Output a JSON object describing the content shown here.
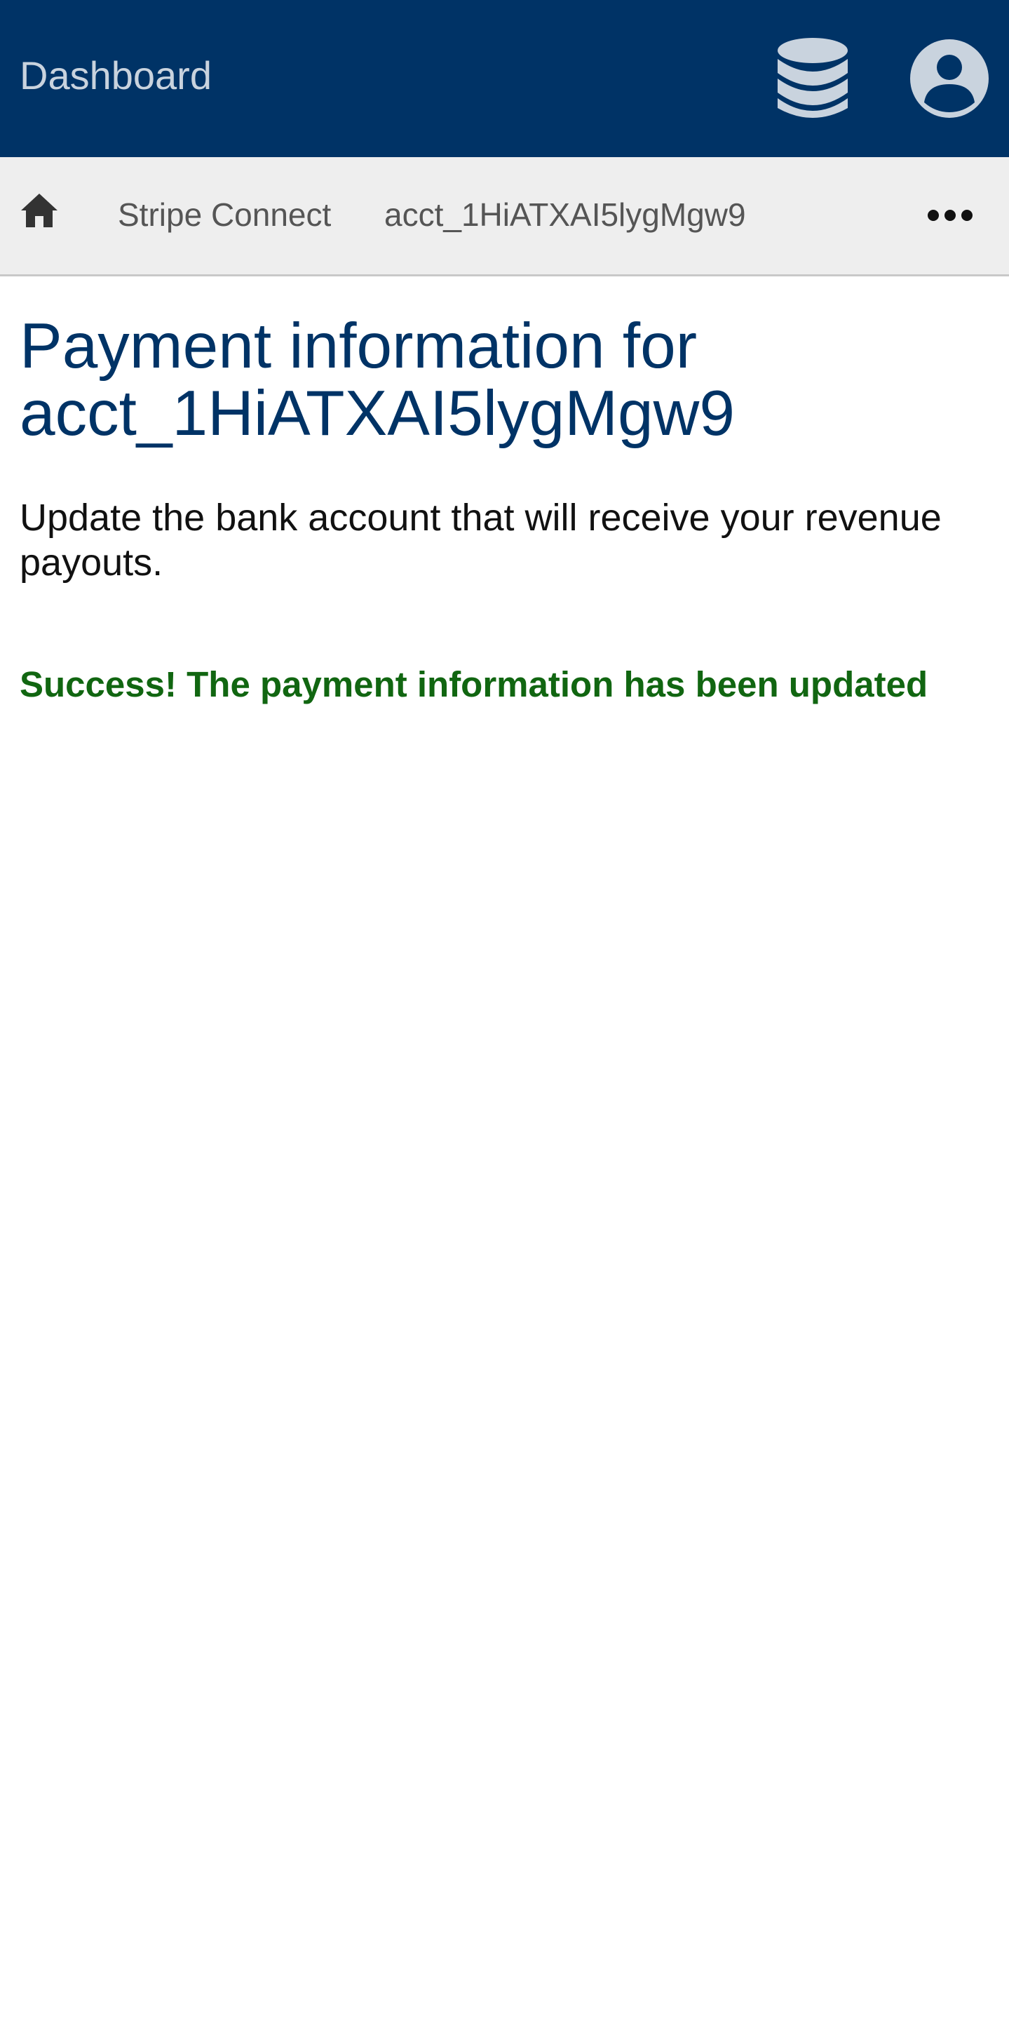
{
  "header": {
    "brand": "Dashboard",
    "icons": [
      "database-icon",
      "user-account-icon"
    ],
    "background_color": "#003366"
  },
  "breadcrumb": {
    "items": [
      "Stripe Connect",
      "acct_1HiATXAI5lygMgw9"
    ],
    "icons": [
      "home-icon",
      "more-options-icon"
    ]
  },
  "main": {
    "title_line1": "Payment information for",
    "title_line2": "acct_1HiATXAI5lygMgw9",
    "subtitle": "Update the bank account that will receive your revenue payouts.",
    "success_message": "Success! The payment information has been updated",
    "success_color": "#116611"
  }
}
